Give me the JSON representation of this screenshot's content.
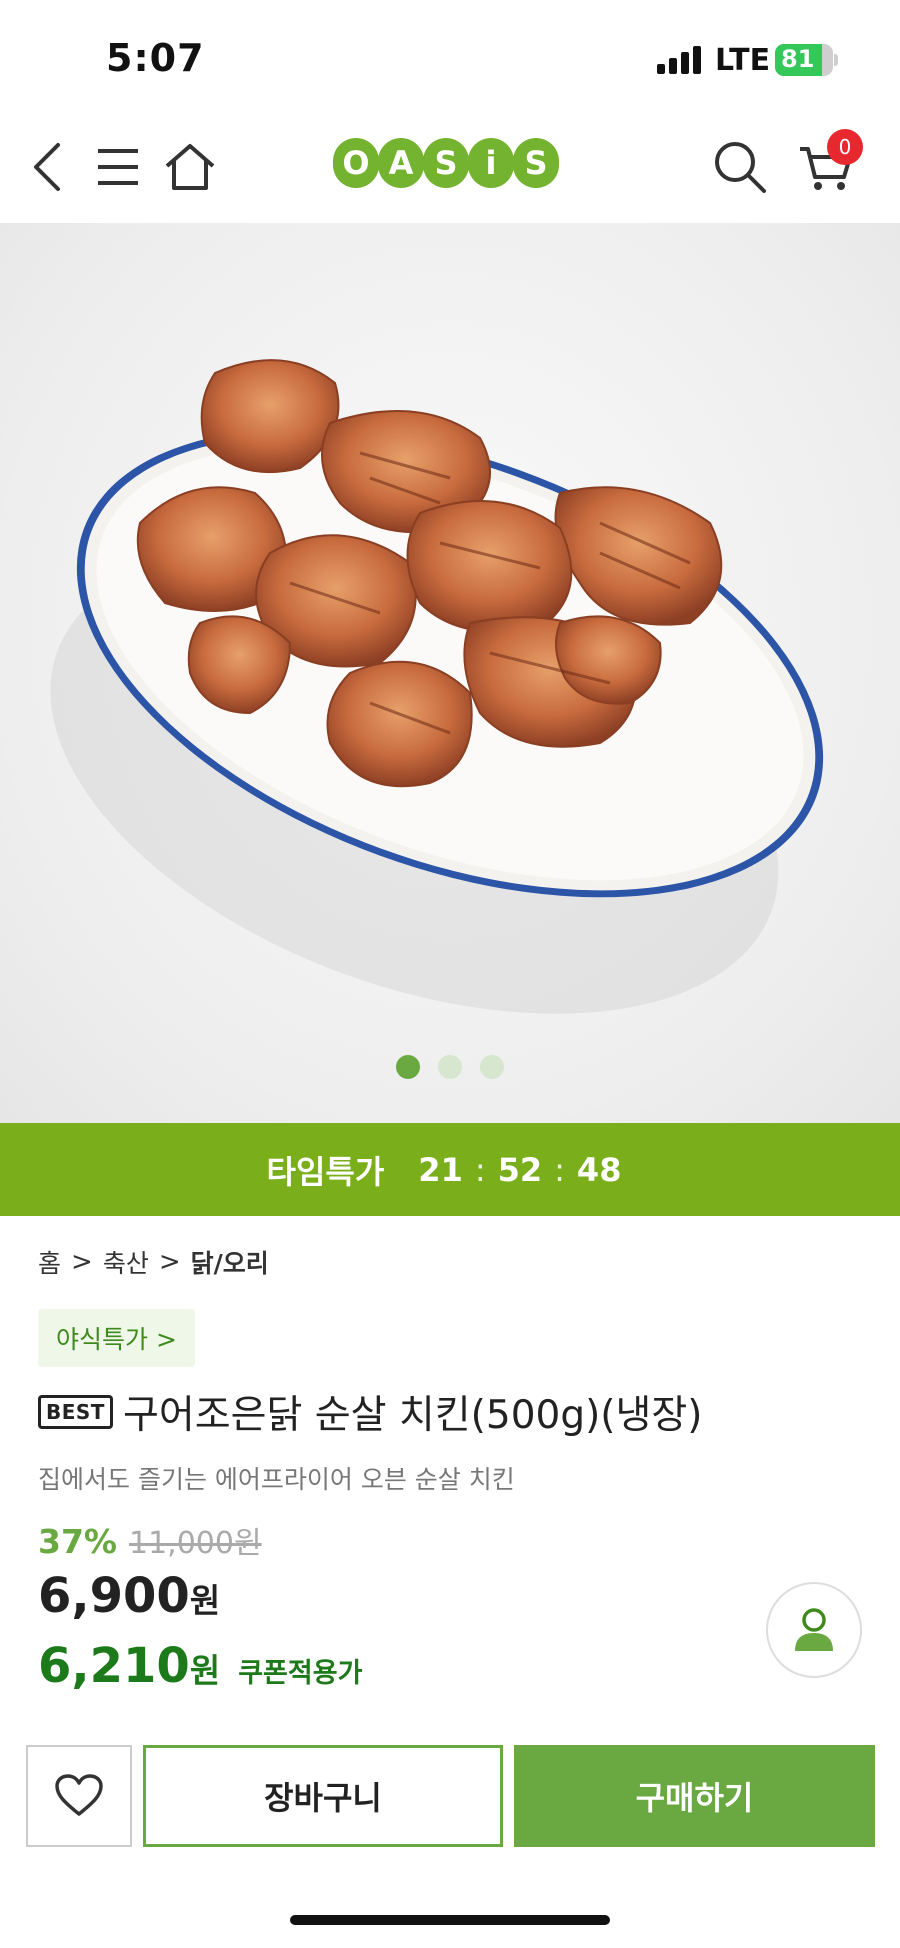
{
  "status_bar": {
    "time": "5:07",
    "network": "LTE",
    "battery": "81",
    "battery_level": 0.81
  },
  "header": {
    "logo_letters": [
      "O",
      "A",
      "S",
      "i",
      "S"
    ],
    "cart_count": "0"
  },
  "gallery": {
    "current_index": 1,
    "total": 3
  },
  "timer": {
    "label": "타임특가",
    "hours": "21",
    "minutes": "52",
    "seconds": "48",
    "separator": ":"
  },
  "breadcrumb": {
    "items": [
      "홈",
      "축산",
      "닭/오리"
    ],
    "separator": ">"
  },
  "event_tag": {
    "label": "야식특가 >"
  },
  "product": {
    "badge": "BEST",
    "name": "구어조은닭 순살 치킨(500g)(냉장)",
    "subtitle": "집에서도 즐기는 에어프라이어 오븐 순살 치킨",
    "discount_rate": "37%",
    "original_price": "11,000원",
    "sale_price": "6,900",
    "coupon_price": "6,210",
    "currency": "원",
    "coupon_label": "쿠폰적용가"
  },
  "actions": {
    "cart_label": "장바구니",
    "buy_label": "구매하기"
  },
  "colors": {
    "brand_green": "#74b32f",
    "timer_green": "#7aae1a",
    "button_green": "#6aa842",
    "coupon_green": "#1d7a1a",
    "badge_red": "#e8282f"
  }
}
